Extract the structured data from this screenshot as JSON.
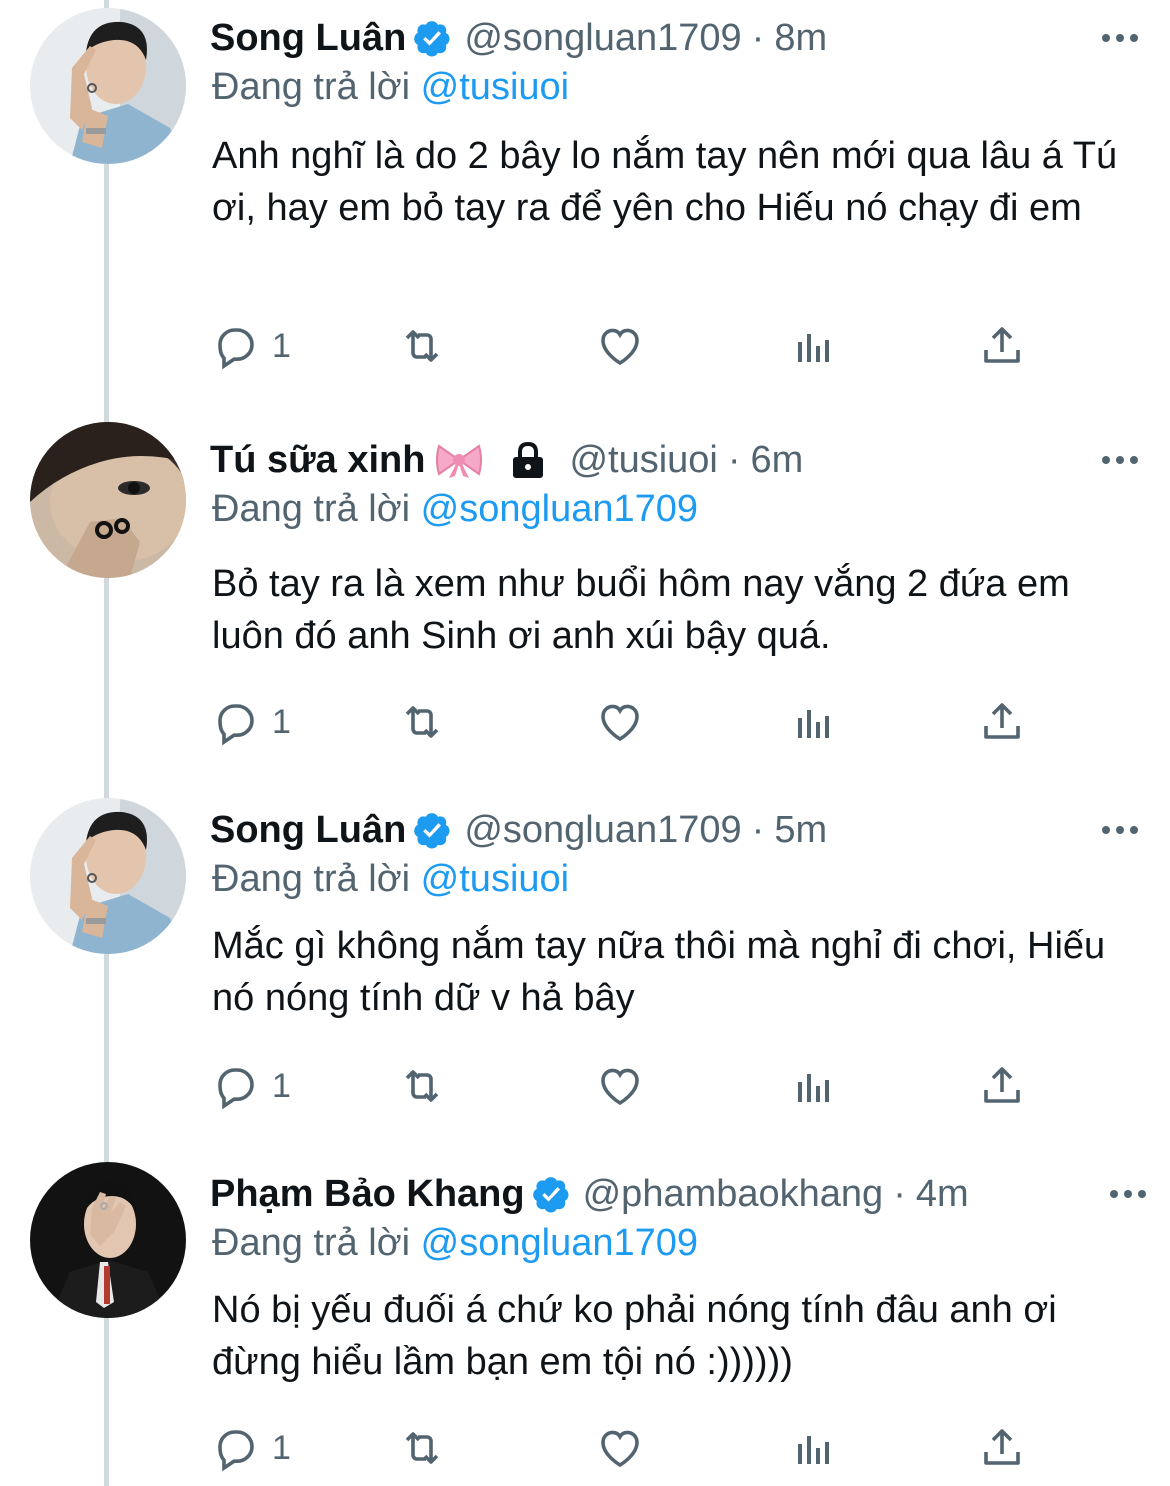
{
  "reply_prefix": "Đang trả lời",
  "tweets": [
    {
      "name": "Song Luân",
      "verified": true,
      "handle": "@songluan1709",
      "separator": "·",
      "time": "8m",
      "reply_to": "@tusiuoi",
      "text": "Anh nghĩ là do 2 bây lo nắm tay nên mới qua lâu á Tú ơi, hay em bỏ tay ra để yên cho Hiếu nó chạy đi em",
      "reply_count": "1",
      "avatar": "avatar-song-luan"
    },
    {
      "name": "Tú sữa xinh",
      "verified": false,
      "bow_emoji": "ribbon-emoji",
      "locked": true,
      "handle": "@tusiuoi",
      "separator": "·",
      "time": "6m",
      "reply_to": "@songluan1709",
      "text": "Bỏ tay ra là xem như buổi hôm nay vắng 2 đứa em luôn đó anh Sinh ơi anh xúi bậy quá.",
      "reply_count": "1",
      "avatar": "avatar-tu-sua-xinh"
    },
    {
      "name": "Song Luân",
      "verified": true,
      "handle": "@songluan1709",
      "separator": "·",
      "time": "5m",
      "reply_to": "@tusiuoi",
      "text": "Mắc gì không nắm tay nữa thôi mà nghỉ đi chơi, Hiếu nó nóng tính dữ v hả bây",
      "reply_count": "1",
      "avatar": "avatar-song-luan"
    },
    {
      "name": "Phạm Bảo Khang",
      "verified": true,
      "handle": "@phambaokhang",
      "separator": "·",
      "time": "4m",
      "reply_to": "@songluan1709",
      "text": "Nó bị yếu đuối á chứ ko phải nóng tính đâu anh ơi đừng hiểu lầm bạn em tội nó :))))))",
      "reply_count": "1",
      "avatar": "avatar-pham-bao-khang"
    }
  ],
  "icons": {
    "verified": "verified-badge-icon",
    "lock": "lock-icon",
    "more": "more-icon",
    "reply": "reply-icon",
    "retweet": "retweet-icon",
    "like": "like-icon",
    "analytics": "analytics-icon",
    "share": "share-icon"
  },
  "colors": {
    "text": "#0f1419",
    "secondary": "#536471",
    "link": "#1d9bf0",
    "verified": "#1d9bf0",
    "thread_line": "#cfd9de"
  }
}
